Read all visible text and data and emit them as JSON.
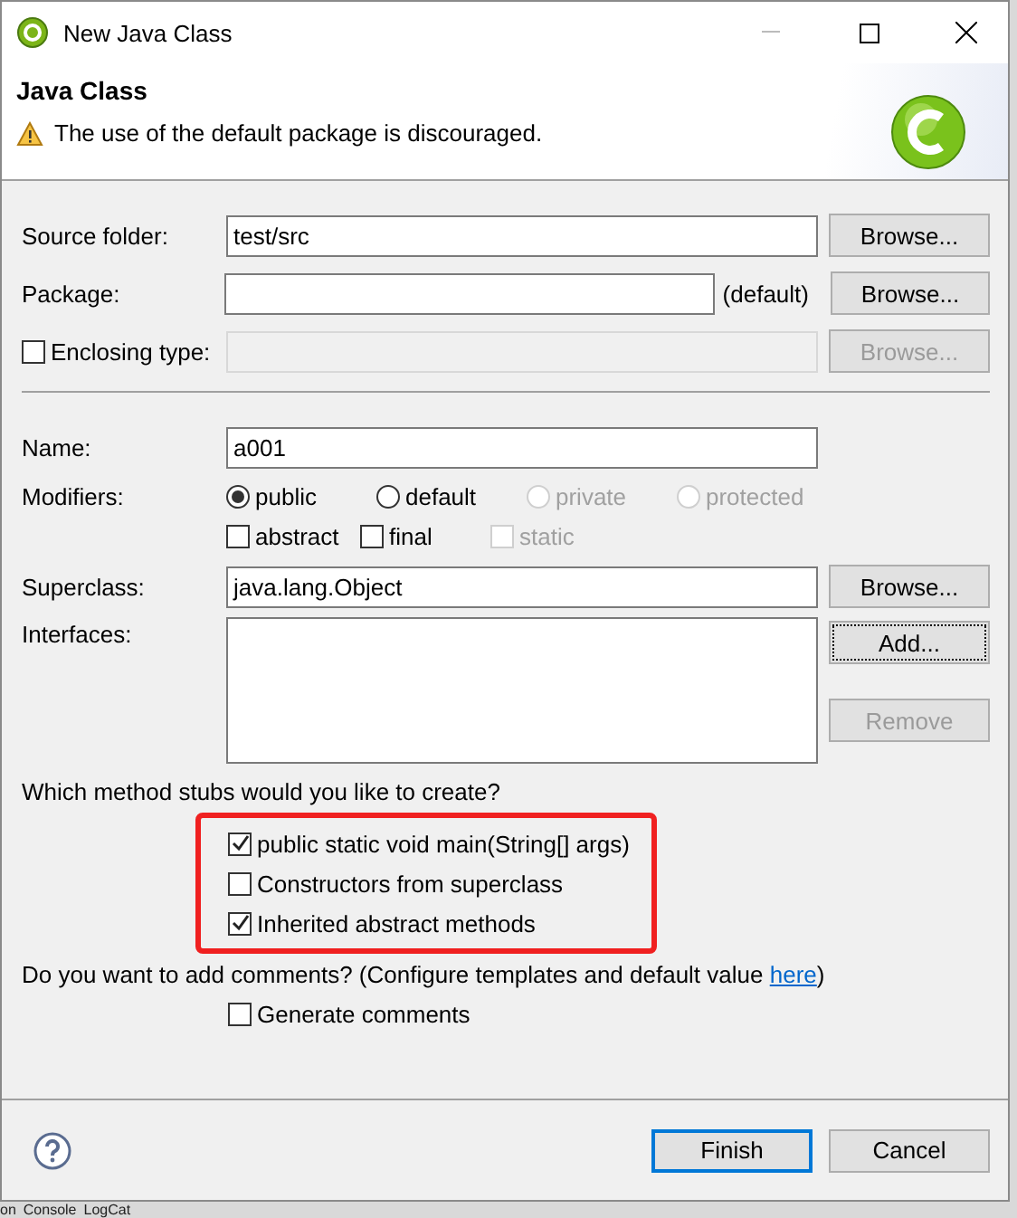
{
  "window": {
    "title": "New Java Class"
  },
  "header": {
    "title": "Java Class",
    "message": "The use of the default package is discouraged."
  },
  "source_folder": {
    "label": "Source folder:",
    "value": "test/src",
    "button": "Browse..."
  },
  "package": {
    "label": "Package:",
    "hint": "(default)",
    "button": "Browse..."
  },
  "enclosing_type": {
    "label": "Enclosing type:",
    "checked": false,
    "disabled": true,
    "button": "Browse..."
  },
  "name": {
    "label": "Name:",
    "value": "a001"
  },
  "modifiers": {
    "label": "Modifiers:",
    "access": [
      {
        "label": "public",
        "selected": true,
        "disabled": false
      },
      {
        "label": "default",
        "selected": false,
        "disabled": false
      },
      {
        "label": "private",
        "selected": false,
        "disabled": true
      },
      {
        "label": "protected",
        "selected": false,
        "disabled": true
      }
    ],
    "flags": [
      {
        "label": "abstract",
        "checked": false,
        "disabled": false
      },
      {
        "label": "final",
        "checked": false,
        "disabled": false
      },
      {
        "label": "static",
        "checked": false,
        "disabled": true
      }
    ]
  },
  "superclass": {
    "label": "Superclass:",
    "value": "java.lang.Object",
    "button": "Browse..."
  },
  "interfaces": {
    "label": "Interfaces:",
    "buttons": [
      {
        "label": "Add...",
        "disabled": false,
        "focused": true
      },
      {
        "label": "Remove",
        "disabled": true,
        "focused": false
      }
    ]
  },
  "stubs": {
    "question": "Which method stubs would you like to create?",
    "highlighted": true,
    "options": [
      {
        "label": "public static void main(String[] args)",
        "checked": true
      },
      {
        "label": "Constructors from superclass",
        "checked": false
      },
      {
        "label": "Inherited abstract methods",
        "checked": true
      }
    ]
  },
  "comments": {
    "question": "Do you want to add comments? (Configure templates and default value ",
    "link": "here",
    "suffix": ")",
    "option": {
      "label": "Generate comments",
      "checked": false
    }
  },
  "footer": {
    "buttons": [
      {
        "label": "Finish",
        "default": true
      },
      {
        "label": "Cancel",
        "default": false
      }
    ]
  },
  "background_tabs": [
    {
      "label": "on"
    },
    {
      "label": "Console"
    },
    {
      "label": "LogCat"
    }
  ]
}
